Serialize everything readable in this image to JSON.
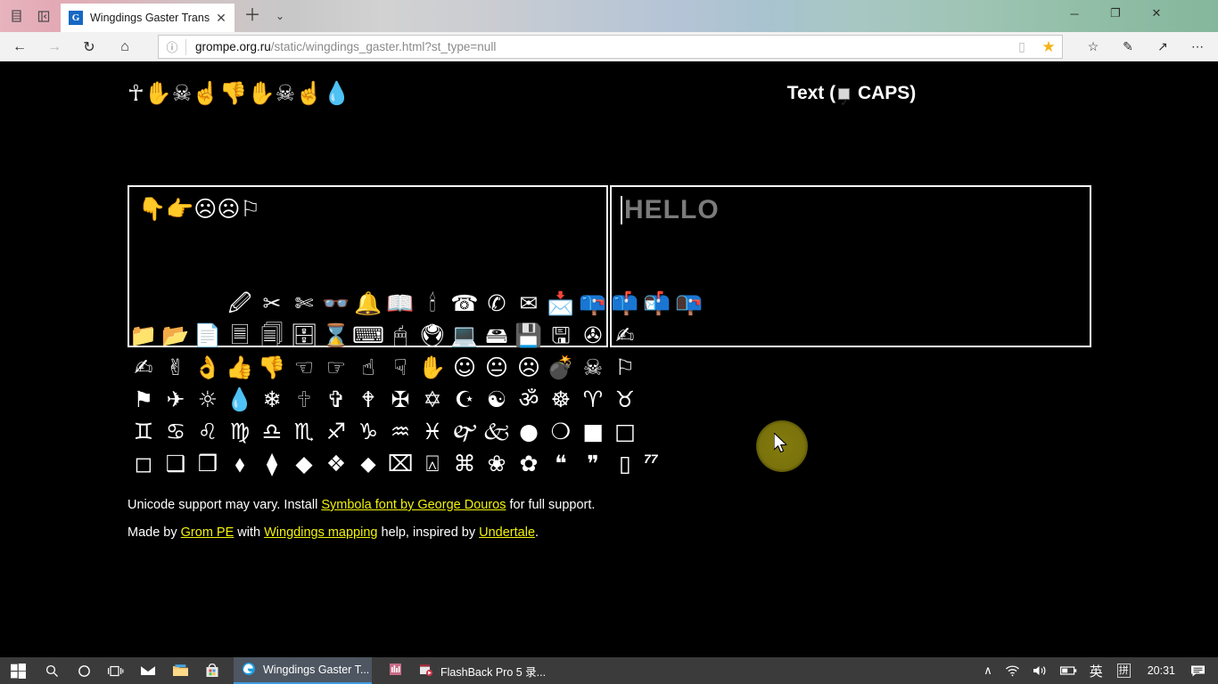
{
  "browser": {
    "tab": {
      "title": "Wingdings Gaster Trans",
      "favicon_letter": "G",
      "close_icon": "✕"
    },
    "newtab_icon": "＋",
    "tablist_icon": "⌄",
    "left_sys_icons": [
      "tab-preview-icon",
      "set-aside-icon"
    ],
    "window_controls": {
      "minimize": "─",
      "maximize": "❐",
      "close": "✕"
    },
    "nav": {
      "back_icon": "←",
      "forward_icon": "→",
      "refresh_icon": "↻",
      "home_icon": "⌂",
      "info_icon": "ⓘ",
      "url_domain": "grompe.org.ru",
      "url_path": "/static/wingdings_gaster.html?st_type=null",
      "reading_view_icon": "▯",
      "favorite_icon": "★",
      "favorites_hub_icon": "☆",
      "notes_icon": "✎",
      "share_icon": "↗",
      "more_icon": "⋯"
    }
  },
  "page": {
    "emoji_strip": "☥✋☠☝👎✋☠☝💧",
    "caps_label_before": "Text (",
    "caps_label_after": " CAPS)",
    "caps_checked": true,
    "left_box": {
      "value": "👇👉☹☹⚐",
      "name": "wingdings-output"
    },
    "right_box": {
      "placeholder": "HELLO",
      "value": ""
    },
    "palette_rows": [
      [
        "",
        "",
        "",
        "🖉",
        "✂",
        "✄",
        "👓",
        "🔔",
        "📖",
        "🕯",
        "☎",
        "✆",
        "✉",
        "📩",
        "📪",
        "📫",
        "📬",
        "📭"
      ],
      [
        "📁",
        "📂",
        "📄",
        "🗏",
        "🗐",
        "🗄",
        "⌛",
        "⌨",
        "🖱",
        "🖲",
        "💻",
        "🖴",
        "💾",
        "🖫",
        "✇",
        "✍"
      ],
      [
        "✍",
        "✌",
        "👌",
        "👍",
        "👎",
        "☜",
        "☞",
        "☝",
        "☟",
        "✋",
        "☺",
        "😐",
        "☹",
        "💣",
        "☠",
        "⚐"
      ],
      [
        "⚑",
        "✈",
        "☼",
        "💧",
        "❄",
        "🕆",
        "✞",
        "🕈",
        "✠",
        "✡",
        "☪",
        "☯",
        "ॐ",
        "☸",
        "♈",
        "♉"
      ],
      [
        "♊",
        "♋",
        "♌",
        "♍",
        "♎",
        "♏",
        "♐",
        "♑",
        "♒",
        "♓",
        "🙰",
        "🙵",
        "●",
        "❍",
        "■",
        "□"
      ],
      [
        "◻",
        "❑",
        "❒",
        "⬧",
        "⧫",
        "◆",
        "❖",
        "⬥",
        "⌧",
        "⍓",
        "⌘",
        "❀",
        "✿",
        "❝",
        "❞",
        "▯"
      ]
    ],
    "count": "77",
    "footer_line1": {
      "pre": "Unicode support may vary. Install ",
      "link": "Symbola font by George Douros",
      "post": " for full support."
    },
    "footer_line2": {
      "pre": "Made by ",
      "link1": "Grom PE",
      "mid1": " with ",
      "link2": "Wingdings mapping",
      "mid2": " help, inspired by ",
      "link3": "Undertale",
      "post": "."
    }
  },
  "taskbar": {
    "start_icon": "windows-logo",
    "pinned": [
      {
        "name": "search-icon",
        "glyph": "🔍"
      },
      {
        "name": "cortana-icon",
        "glyph": "◯"
      },
      {
        "name": "task-view-icon",
        "glyph": "🗗"
      },
      {
        "name": "mail-icon",
        "glyph": "✉"
      },
      {
        "name": "file-explorer-icon",
        "glyph": "📁"
      },
      {
        "name": "microsoft-store-icon",
        "glyph": "🛍"
      }
    ],
    "apps": [
      {
        "name": "edge-window",
        "label": "Wingdings Gaster T...",
        "active": true
      },
      {
        "name": "unknown-window",
        "label": "",
        "active": false
      },
      {
        "name": "flashback-window",
        "label": "FlashBack Pro 5 录...",
        "active": false
      }
    ],
    "tray": {
      "overflow_icon": "∧",
      "network_icon": "wifi-icon",
      "volume_icon": "🔊",
      "battery_icon": "🔋",
      "ime_lang": "英",
      "ime_mode": "拼",
      "clock": "20:31",
      "action_center_icon": "🗨"
    }
  },
  "colors": {
    "page_bg": "#000000",
    "link": "#f2f20a",
    "placeholder": "#7b7b7b",
    "taskbar": "#3b3b3b",
    "cursor_halo": "#8a820e"
  }
}
